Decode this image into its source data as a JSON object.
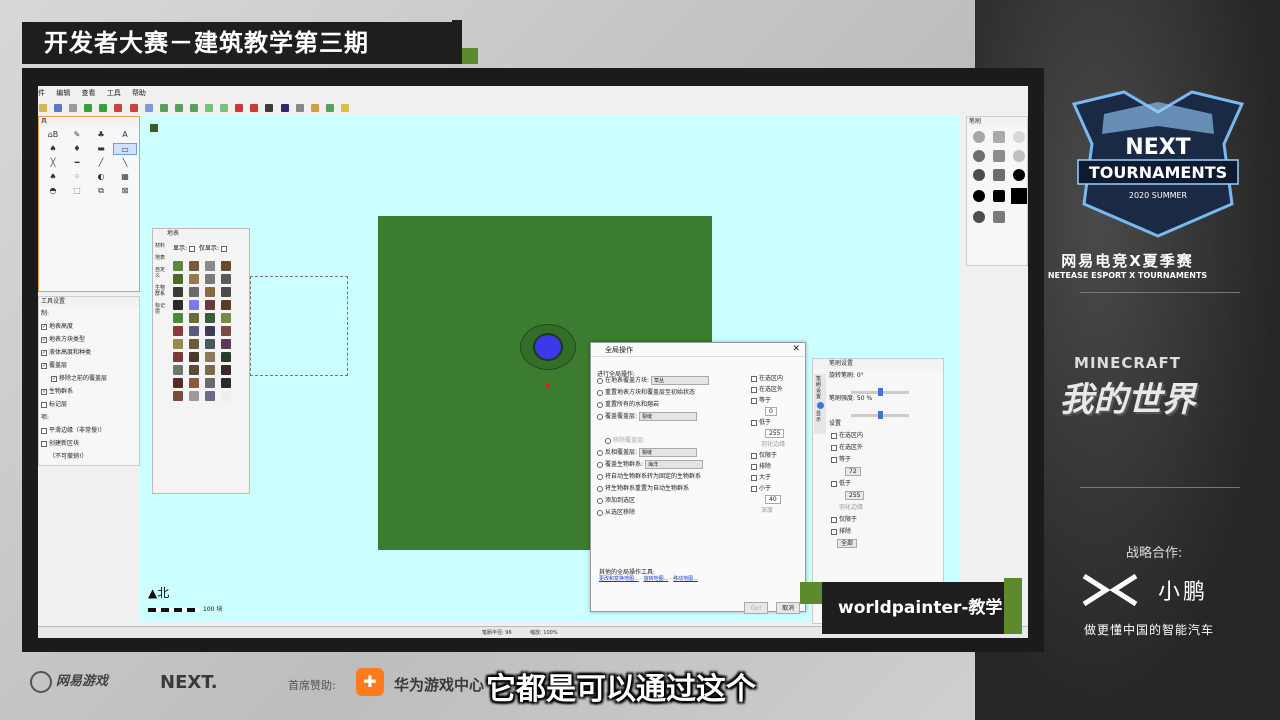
{
  "broadcast": {
    "title": "开发者大赛－建筑教学第三期",
    "episode_tag": "worldpainter-教学",
    "subtitle": "它都是可以通过这个",
    "sponsor_label": "首席赞助:",
    "sponsor_name": "华为游戏中心",
    "netease_game_logo": "网易游戏",
    "next_logo_text": "NEXT.",
    "right_panel": {
      "tournament_logo_top": "NEXT",
      "tournament_logo_main": "TOURNAMENTS",
      "tournament_logo_season": "2020 SUMMER",
      "event_cn": "网易电竞X夏季赛",
      "event_en": "NETEASE ESPORT X TOURNAMENTS",
      "minecraft_en": "MINECRAFT",
      "minecraft_cn": "我的世界",
      "partner_label": "战略合作:",
      "partner_name": "小鹏",
      "partner_slogan": "做更懂中国的智能汽车"
    }
  },
  "app": {
    "menu": [
      "件",
      "编辑",
      "查看",
      "工具",
      "帮助"
    ],
    "tool_panel": {
      "title": "具",
      "tools": [
        "⌂B",
        "✎",
        "♣",
        "A",
        "♠",
        "♦",
        "▬",
        "▭",
        "╳",
        "━",
        "╱",
        "╲",
        "♠",
        "⁘",
        "◐",
        "▦",
        "◓",
        "⬚",
        "⧉",
        "⊠"
      ]
    },
    "tool_settings": {
      "title": "工具设置",
      "label_show": "制:",
      "items": [
        {
          "label": "地表高度",
          "checked": true
        },
        {
          "label": "地表方块类型",
          "checked": true
        },
        {
          "label": "液体高度和种类",
          "checked": true
        },
        {
          "label": "覆盖层",
          "checked": true
        },
        {
          "label": "移除之前的覆盖层",
          "checked": true
        },
        {
          "label": "生物群系",
          "checked": true
        },
        {
          "label": "标记层",
          "checked": false
        }
      ],
      "label_options": "项:",
      "opt_smooth": "平滑边缘（非常慢!）",
      "opt_new": "创建新区块",
      "opt_undo": "（不可撤销!）"
    },
    "terrain_panel": {
      "title": "地表",
      "show_label": "显示:",
      "show_only_label": "仅显示:",
      "side_tabs": [
        "材料",
        "地表",
        "自定义",
        "生物群系",
        "标记层"
      ]
    },
    "compass": "▲北",
    "scale_label": "100 块",
    "dialog": {
      "title": "全局操作",
      "section": "进行全局操作:",
      "options": [
        {
          "label": "在地表覆盖方块:",
          "combo": "草丛"
        },
        {
          "label": "重置地表方块和覆盖层至初始状态",
          "combo": ""
        },
        {
          "label": "重置所有的水和熔岩",
          "combo": ""
        },
        {
          "label": "覆盖覆盖层:",
          "combo": "裂缝"
        },
        {
          "label": "移除覆盖层:",
          "combo": ""
        },
        {
          "label": "反相覆盖层:",
          "combo": "裂缝"
        },
        {
          "label": "覆盖生物群系:",
          "combo": "海洋"
        },
        {
          "label": "将自动生物群系转为固定的生物群系",
          "combo": ""
        },
        {
          "label": "将生物群系重置为自动生物群系",
          "combo": ""
        },
        {
          "label": "添加到选区",
          "combo": ""
        },
        {
          "label": "从选区移除",
          "combo": ""
        }
      ],
      "right_opts": [
        "在选区内",
        "在选区外",
        "等于",
        "0",
        "低于",
        "255",
        "羽化边缘",
        "仅限于",
        "排除",
        "大于",
        "小于",
        "40",
        "深度"
      ],
      "other_tools_label": "其他的全局操作工具:",
      "links": [
        "更改和变换地图...",
        "旋转地图...",
        "移动地图..."
      ],
      "go_label": "Go!",
      "cancel_label": "取消"
    },
    "brush_settings": {
      "title": "笔刷设置",
      "rotation_label": "旋转笔刷: 0°",
      "rotation": 0,
      "intensity_label": "笔刷强度: 50 %",
      "intensity": 0.5,
      "section": "设置",
      "items": [
        "在选区内",
        "在选区外",
        "等于",
        "72",
        "低于",
        "255",
        "羽化边缘",
        "仅限于",
        "排除",
        "全部"
      ],
      "side_tabs": [
        "笔刷设置",
        "显示"
      ]
    },
    "brush_palette": {
      "title": "笔刷"
    },
    "status": {
      "brush_size": "笔刷半径: 96",
      "zoom": "缩放: 100%"
    }
  },
  "colors": {
    "canvas_bg": "#ccffff",
    "world_green": "#3c7c30",
    "brush_blue": "#3a3ae8",
    "accent_green": "#5e8a2e",
    "sponsor_orange": "#ff7b1c"
  }
}
